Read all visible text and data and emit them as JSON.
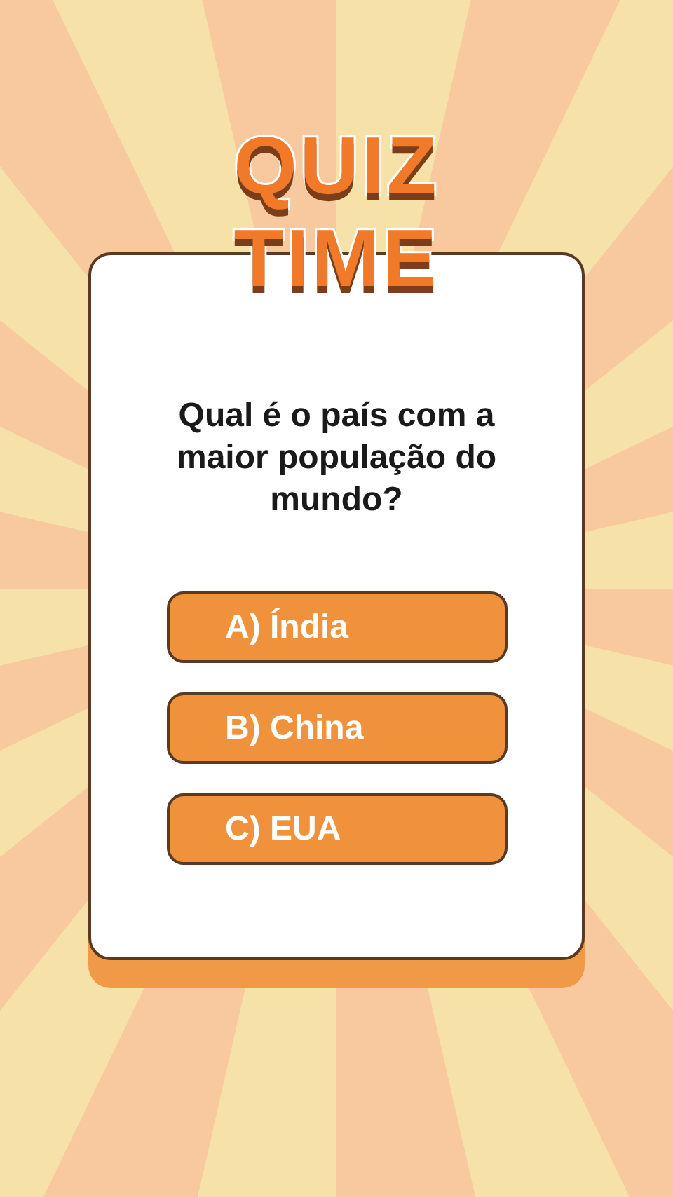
{
  "logo": {
    "lines": [
      "QUIZ",
      "TIME"
    ]
  },
  "question": "Qual é o país com a maior população do mundo?",
  "options": [
    {
      "label": "A) Índia"
    },
    {
      "label": "B) China"
    },
    {
      "label": "C) EUA"
    }
  ]
}
